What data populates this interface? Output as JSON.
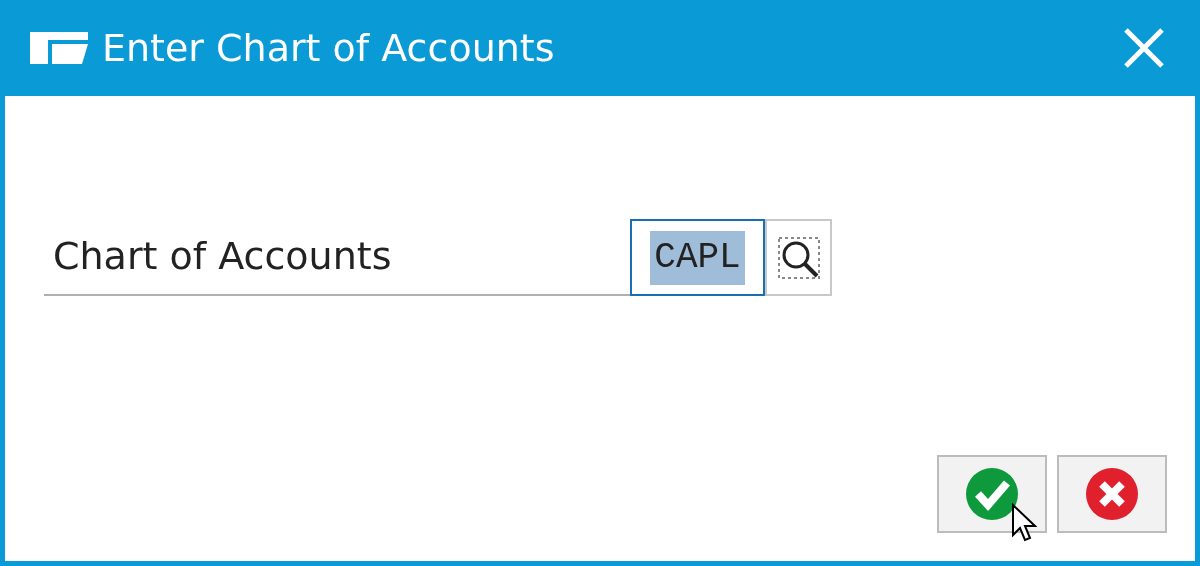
{
  "window": {
    "title": "Enter Chart of Accounts"
  },
  "field": {
    "label": "Chart of Accounts",
    "value": "CAPL",
    "text_selected": true
  },
  "buttons": [
    {
      "kind": "confirm"
    },
    {
      "kind": "cancel"
    }
  ]
}
